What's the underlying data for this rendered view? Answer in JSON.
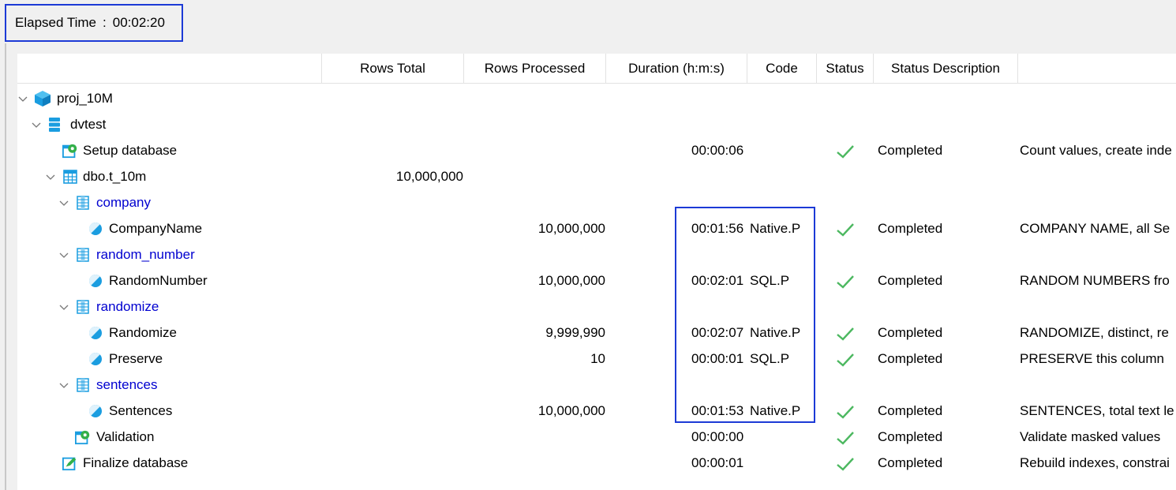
{
  "elapsed": {
    "label": "Elapsed Time",
    "separator": ":",
    "value": "00:02:20"
  },
  "columns": [
    "Rows Total",
    "Rows Processed",
    "Duration (h:m:s)",
    "Code",
    "Status",
    "Status Description"
  ],
  "rows": [
    {
      "name": "proj_10M",
      "kind": "project",
      "icon": "project-cube-icon",
      "total": "",
      "processed": "",
      "duration": "",
      "code": "",
      "status": "",
      "description": ""
    },
    {
      "name": "dvtest",
      "kind": "database",
      "icon": "database-icon",
      "total": "",
      "processed": "",
      "duration": "",
      "code": "",
      "status": "",
      "description": ""
    },
    {
      "name": "Setup database",
      "kind": "task",
      "icon": "setup-gear-icon",
      "total": "",
      "processed": "",
      "duration": "00:00:06",
      "code": "",
      "status": "Completed",
      "description": "Count values, create inde"
    },
    {
      "name": "dbo.t_10m",
      "kind": "table",
      "icon": "table-icon",
      "total": "10,000,000",
      "processed": "",
      "duration": "",
      "code": "",
      "status": "",
      "description": ""
    },
    {
      "name": "company",
      "kind": "group",
      "icon": "column-group-icon",
      "total": "",
      "processed": "",
      "duration": "",
      "code": "",
      "status": "",
      "description": ""
    },
    {
      "name": "CompanyName",
      "kind": "column",
      "icon": "mask-column-icon",
      "total": "",
      "processed": "10,000,000",
      "duration": "00:01:56",
      "code": "Native.P",
      "status": "Completed",
      "description": "COMPANY NAME, all Se"
    },
    {
      "name": "random_number",
      "kind": "group",
      "icon": "column-group-icon",
      "total": "",
      "processed": "",
      "duration": "",
      "code": "",
      "status": "",
      "description": ""
    },
    {
      "name": "RandomNumber",
      "kind": "column",
      "icon": "mask-column-icon",
      "total": "",
      "processed": "10,000,000",
      "duration": "00:02:01",
      "code": "SQL.P",
      "status": "Completed",
      "description": "RANDOM NUMBERS fro"
    },
    {
      "name": "randomize",
      "kind": "group",
      "icon": "column-group-icon",
      "total": "",
      "processed": "",
      "duration": "",
      "code": "",
      "status": "",
      "description": ""
    },
    {
      "name": "Randomize",
      "kind": "column",
      "icon": "mask-column-icon",
      "total": "",
      "processed": "9,999,990",
      "duration": "00:02:07",
      "code": "Native.P",
      "status": "Completed",
      "description": "RANDOMIZE, distinct, re"
    },
    {
      "name": "Preserve",
      "kind": "column",
      "icon": "mask-column-icon",
      "total": "",
      "processed": "10",
      "duration": "00:00:01",
      "code": "SQL.P",
      "status": "Completed",
      "description": "PRESERVE this column"
    },
    {
      "name": "sentences",
      "kind": "group",
      "icon": "column-group-icon",
      "total": "",
      "processed": "",
      "duration": "",
      "code": "",
      "status": "",
      "description": ""
    },
    {
      "name": "Sentences",
      "kind": "column",
      "icon": "mask-column-icon",
      "total": "",
      "processed": "10,000,000",
      "duration": "00:01:53",
      "code": "Native.P",
      "status": "Completed",
      "description": "SENTENCES, total text le"
    },
    {
      "name": "Validation",
      "kind": "task",
      "icon": "validation-gear-icon",
      "total": "",
      "processed": "",
      "duration": "00:00:00",
      "code": "",
      "status": "Completed",
      "description": "Validate masked values"
    },
    {
      "name": "Finalize database",
      "kind": "task",
      "icon": "finalize-edit-icon",
      "total": "",
      "processed": "",
      "duration": "00:00:01",
      "code": "",
      "status": "Completed",
      "description": "Rebuild indexes, constrai"
    }
  ],
  "colors": {
    "accent": "#1c3ad6",
    "group_text": "#0000d0",
    "icon_blue": "#1a9de0",
    "check_green": "#4cb860"
  }
}
